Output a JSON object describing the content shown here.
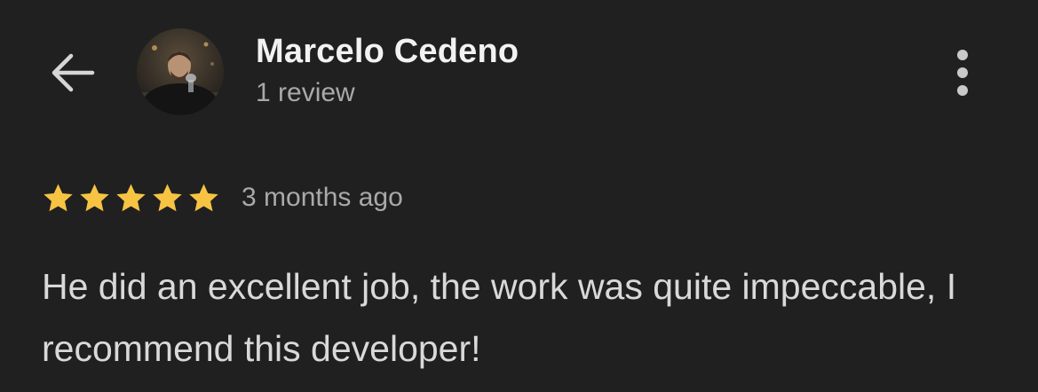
{
  "header": {
    "reviewer_name": "Marcelo Cedeno",
    "review_count": "1 review"
  },
  "review": {
    "rating": 5,
    "rating_max": 5,
    "date": "3 months ago",
    "text": "He did an excellent job, the work was quite impeccable, I recommend this developer!"
  },
  "icons": {
    "back": "arrow-left-icon",
    "more": "more-vertical-icon",
    "star": "star-icon"
  },
  "colors": {
    "background": "#202020",
    "star": "#f6c343",
    "primary_text": "#f2f2f2",
    "secondary_text": "#a9a9a9"
  }
}
